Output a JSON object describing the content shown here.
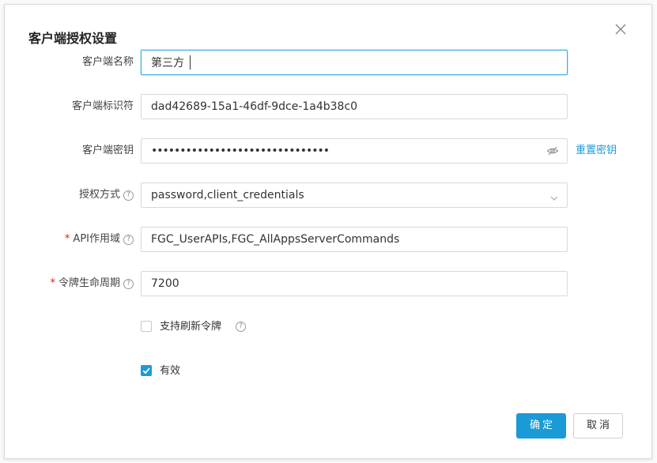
{
  "dialog": {
    "title": "客户端授权设置",
    "fields": {
      "client_name": {
        "label": "客户端名称",
        "value": "第三方"
      },
      "client_id": {
        "label": "客户端标识符",
        "value": "dad42689-15a1-46df-9dce-1a4b38c0"
      },
      "client_secret": {
        "label": "客户端密钥",
        "value": "•••••••••••••••••••••••••••••••",
        "reset_label": "重置密钥"
      },
      "grant_type": {
        "label": "授权方式",
        "value": "password,client_credentials"
      },
      "api_scope": {
        "required_mark": "*",
        "label": "API作用域",
        "value": "FGC_UserAPIs,FGC_AllAppsServerCommands"
      },
      "token_lifetime": {
        "required_mark": "*",
        "label": "令牌生命周期",
        "value": "7200"
      }
    },
    "checkboxes": {
      "refresh_token": {
        "label": "支持刷新令牌",
        "checked": false
      },
      "enabled": {
        "label": "有效",
        "checked": true
      }
    },
    "help_glyph": "?",
    "buttons": {
      "ok": "确定",
      "cancel": "取消"
    },
    "colors": {
      "accent": "#1a9bd7",
      "required": "#e02020",
      "focus_border": "#3ab0e2"
    }
  }
}
